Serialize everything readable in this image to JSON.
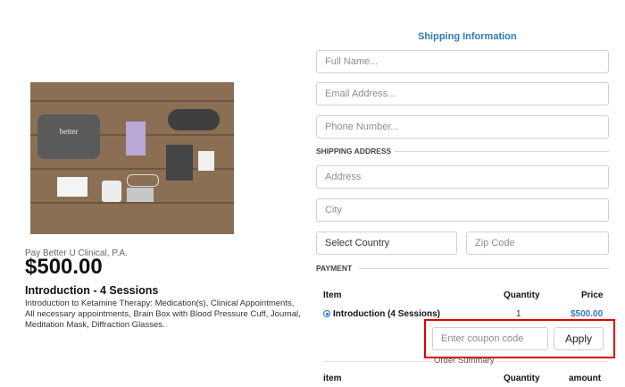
{
  "product": {
    "merchant": "Pay Better U Clinical, P.A.",
    "price": "$500.00",
    "title": "Introduction - 4 Sessions",
    "description": "Introduction to Ketamine Therapy: Medication(s), Clinical Appointments, All necessary appointments, Brain Box with Blood Pressure Cuff, Journal, Meditation Mask, Diffraction Glasses.",
    "image_logo_text": "better"
  },
  "shipping": {
    "heading": "Shipping Information",
    "full_name_placeholder": "Full Name...",
    "email_placeholder": "Email Address...",
    "phone_placeholder": "Phone Number...",
    "address_section": "SHIPPING ADDRESS",
    "address_placeholder": "Address",
    "city_placeholder": "City",
    "country_value": "Select Country",
    "zip_placeholder": "Zip Code"
  },
  "payment": {
    "section": "PAYMENT",
    "headers": {
      "item": "Item",
      "quantity": "Quantity",
      "price": "Price"
    },
    "row": {
      "label": "Introduction (4 Sessions)",
      "quantity": "1",
      "price": "$500.00"
    },
    "coupon_placeholder": "Enter coupon code",
    "apply_label": "Apply"
  },
  "summary": {
    "title": "Order Summary",
    "headers": {
      "item": "item",
      "quantity": "Quantity",
      "amount": "amount"
    }
  },
  "colors": {
    "accent": "#2f79bd",
    "highlight": "#e30000",
    "radio": "#1a73e8"
  }
}
